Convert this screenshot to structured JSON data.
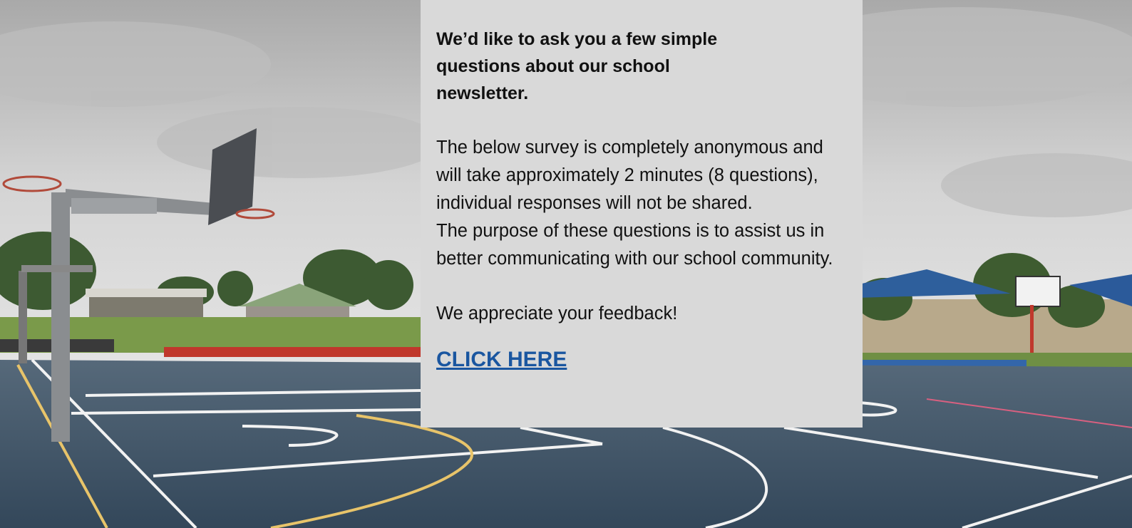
{
  "heading": "We’d like to ask you a few simple questions about our school newsletter.",
  "body": {
    "paragraph_1": "The below survey is completely anonymous and will take approximately 2 minutes (8 questions), individual responses will not be shared.",
    "paragraph_2": "The purpose of these questions is to assist us in better communicating with our school community.",
    "paragraph_3": "We appreciate your feedback!"
  },
  "cta": {
    "label": "CLICK HERE"
  },
  "photo": {
    "subject": "school basketball court with hoops, shelters and trees under cloudy sky",
    "colors": {
      "sky": "#c9c9c9",
      "court": "#3f5468",
      "court_line": "#f2f2f2",
      "key_line": "#e8c46a",
      "shelter": "#2e5f9c",
      "panel": "#d9d9d9",
      "link": "#1a56a0"
    }
  }
}
